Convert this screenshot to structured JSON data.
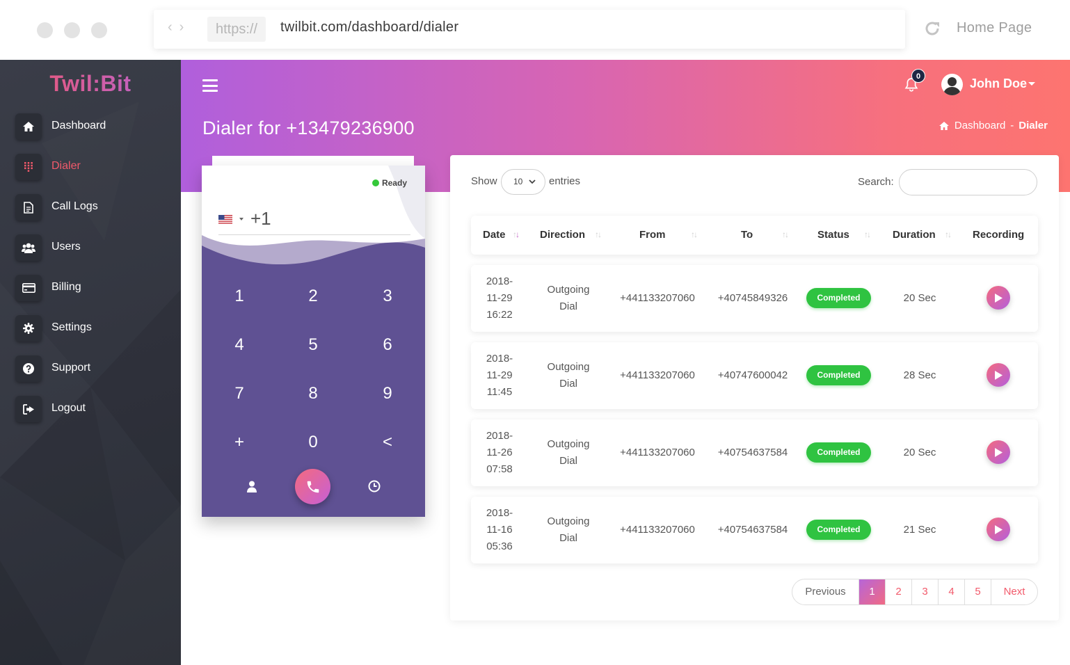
{
  "browser": {
    "url_protocol": "https://",
    "url": "twilbit.com/dashboard/dialer",
    "home_link": "Home Page"
  },
  "sidebar": {
    "logo": "Twil:Bit",
    "items": [
      {
        "label": "Dashboard",
        "icon": "home-icon"
      },
      {
        "label": "Dialer",
        "icon": "keypad-icon",
        "active": true
      },
      {
        "label": "Call Logs",
        "icon": "document-icon"
      },
      {
        "label": "Users",
        "icon": "users-icon"
      },
      {
        "label": "Billing",
        "icon": "credit-card-icon"
      },
      {
        "label": "Settings",
        "icon": "gear-icon"
      },
      {
        "label": "Support",
        "icon": "question-icon"
      },
      {
        "label": "Logout",
        "icon": "logout-icon"
      }
    ]
  },
  "header": {
    "page_title": "Dialer for +13479236900",
    "breadcrumb": {
      "home": "Dashboard",
      "separator": "-",
      "current": "Dialer"
    },
    "notifications_count": "0",
    "user_name": "John Doe"
  },
  "dialer": {
    "status": "Ready",
    "dial_code": "+1",
    "keys": [
      "1",
      "2",
      "3",
      "4",
      "5",
      "6",
      "7",
      "8",
      "9",
      "+",
      "0",
      "<"
    ]
  },
  "table": {
    "show_label": "Show",
    "entries_value": "10",
    "entries_label": "entries",
    "search_label": "Search:",
    "columns": [
      "Date",
      "Direction",
      "From",
      "To",
      "Status",
      "Duration",
      "Recording"
    ],
    "rows": [
      {
        "date": [
          "2018-",
          "11-29",
          "16:22"
        ],
        "direction": [
          "Outgoing",
          "Dial"
        ],
        "from": "+441133207060",
        "to": "+40745849326",
        "status": "Completed",
        "duration": "20 Sec"
      },
      {
        "date": [
          "2018-",
          "11-29",
          "11:45"
        ],
        "direction": [
          "Outgoing",
          "Dial"
        ],
        "from": "+441133207060",
        "to": "+40747600042",
        "status": "Completed",
        "duration": "28 Sec"
      },
      {
        "date": [
          "2018-",
          "11-26",
          "07:58"
        ],
        "direction": [
          "Outgoing",
          "Dial"
        ],
        "from": "+441133207060",
        "to": "+40754637584",
        "status": "Completed",
        "duration": "20 Sec"
      },
      {
        "date": [
          "2018-",
          "11-16",
          "05:36"
        ],
        "direction": [
          "Outgoing",
          "Dial"
        ],
        "from": "+441133207060",
        "to": "+40754637584",
        "status": "Completed",
        "duration": "21 Sec"
      }
    ]
  },
  "pagination": {
    "previous": "Previous",
    "pages": [
      "1",
      "2",
      "3",
      "4",
      "5"
    ],
    "current": "1",
    "next": "Next"
  },
  "colors": {
    "accent": "#f25a6b",
    "header_start": "#b05fdc",
    "header_end": "#fd7470",
    "dialer_bg": "#5f5193",
    "status_green": "#2fc341"
  }
}
